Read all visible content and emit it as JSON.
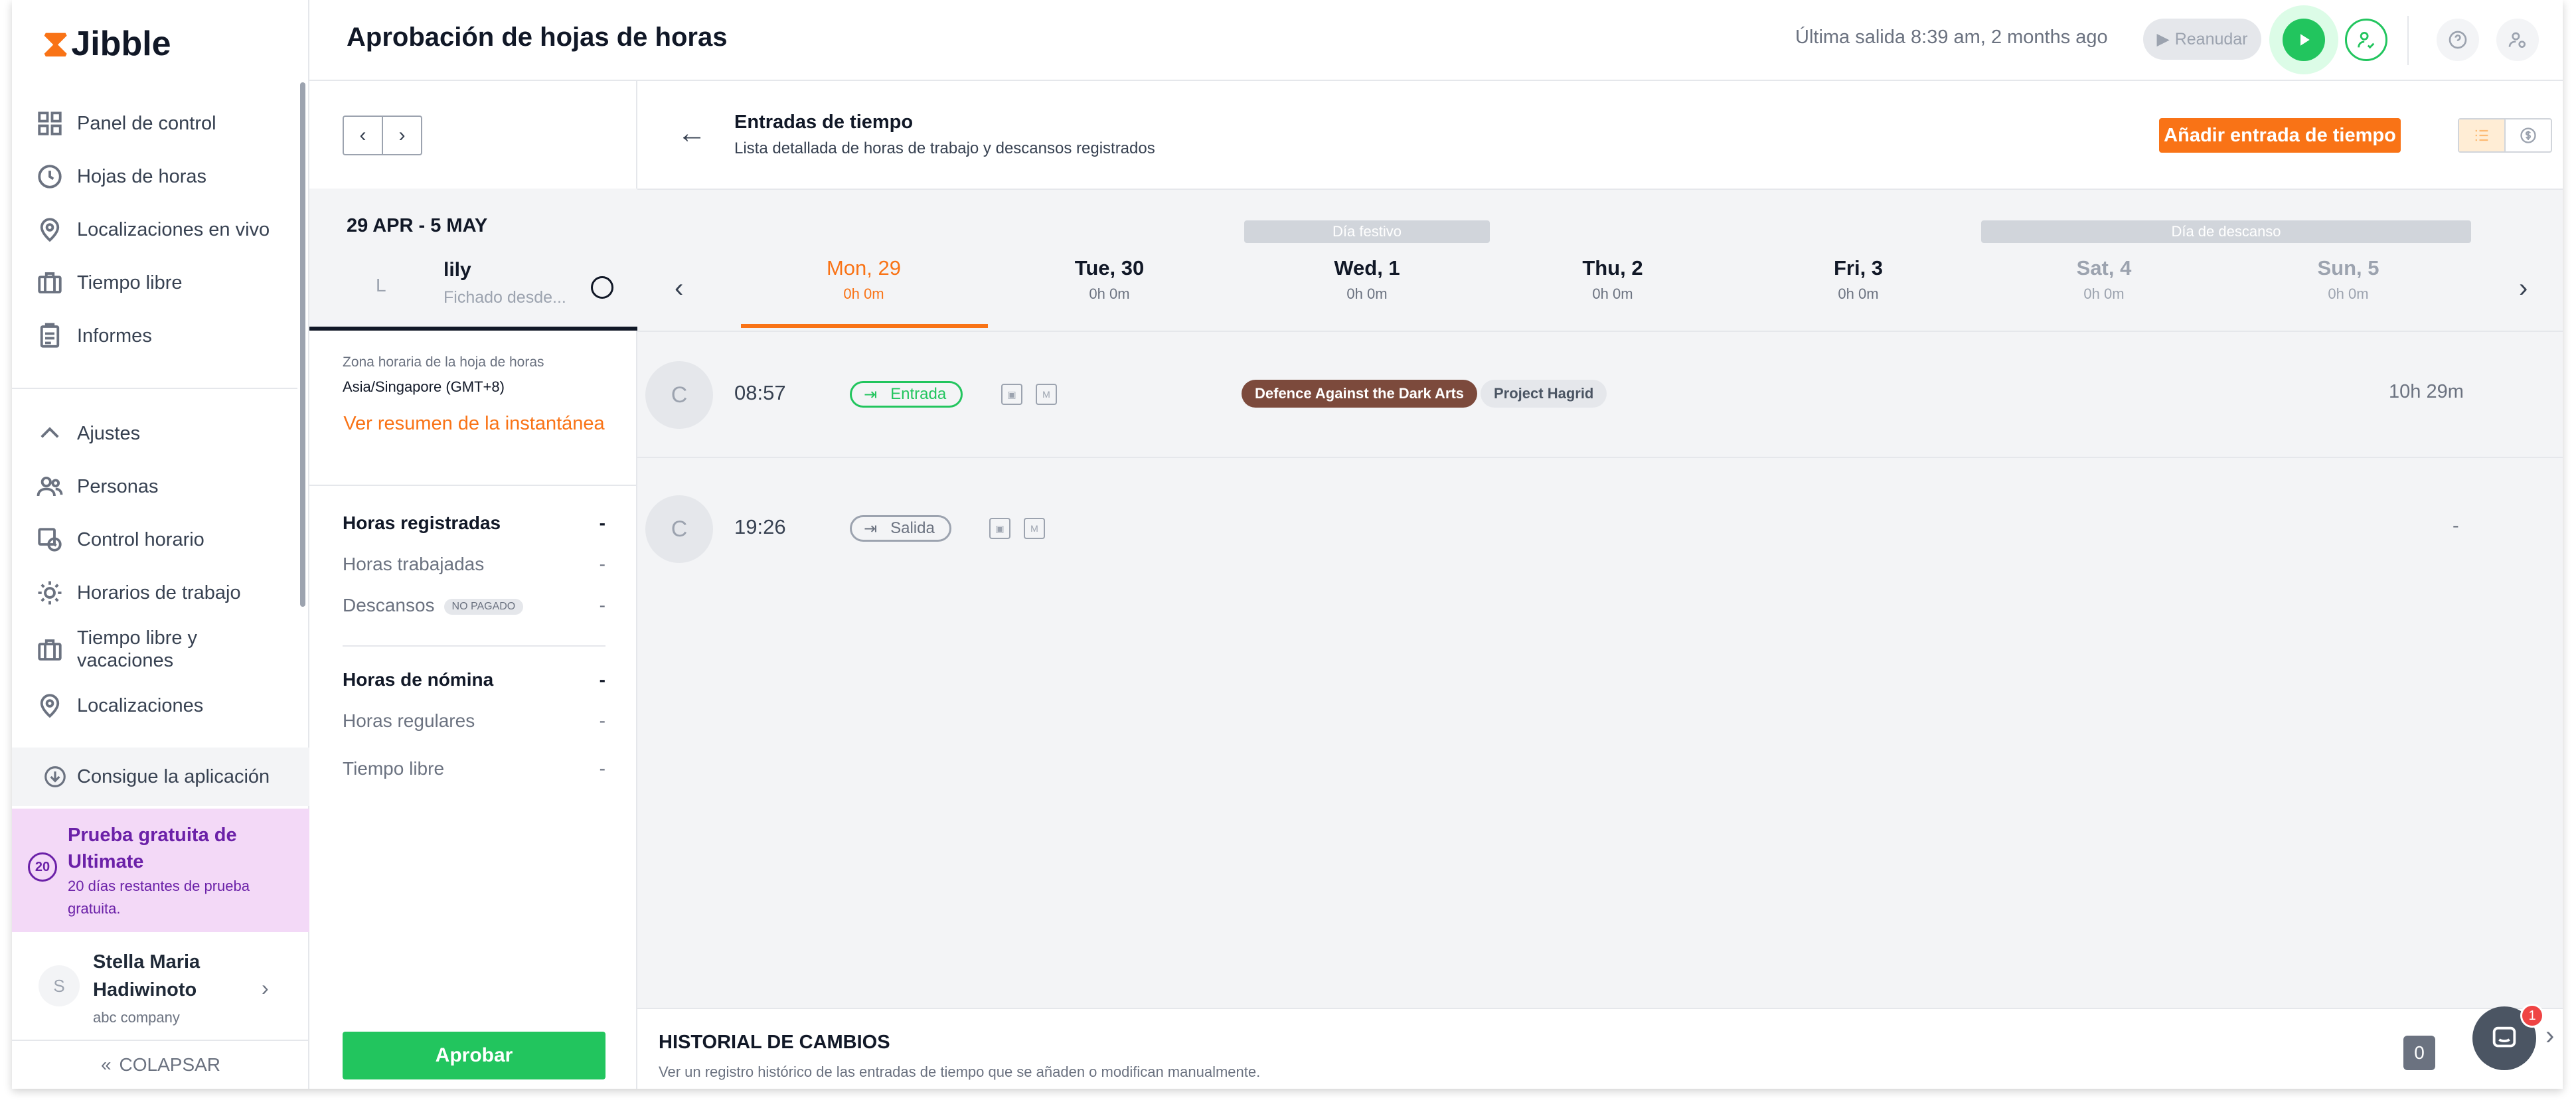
{
  "brand": {
    "name": "Jibble",
    "mark": "⧗"
  },
  "sidebar": {
    "items_top": [
      {
        "label": "Panel de control",
        "icon": "dashboard-icon"
      },
      {
        "label": "Hojas de horas",
        "icon": "clock-icon"
      },
      {
        "label": "Localizaciones en vivo",
        "icon": "location-pin-icon"
      },
      {
        "label": "Tiempo libre",
        "icon": "suitcase-icon"
      },
      {
        "label": "Informes",
        "icon": "clipboard-icon"
      }
    ],
    "settings_label": "Ajustes",
    "items_settings": [
      {
        "label": "Personas",
        "icon": "people-icon"
      },
      {
        "label": "Control horario",
        "icon": "time-tracking-icon"
      },
      {
        "label": "Horarios de trabajo",
        "icon": "schedule-icon"
      },
      {
        "label": "Tiempo libre y vacaciones",
        "icon": "suitcase-icon"
      },
      {
        "label": "Localizaciones",
        "icon": "location-pin-icon"
      }
    ],
    "get_app": "Consigue la aplicación",
    "trial": {
      "days": "20",
      "title": "Prueba gratuita de Ultimate",
      "subtitle": "20 días restantes de prueba gratuita."
    },
    "user": {
      "initial": "S",
      "name": "Stella Maria Hadiwinoto",
      "company": "abc company"
    },
    "collapse": "COLAPSAR"
  },
  "topbar": {
    "title": "Aprobación de hojas de horas",
    "last_exit": "Última salida 8:39 am, 2 months ago",
    "resume": "Reanudar"
  },
  "left_panel": {
    "week_range": "29 APR - 5 MAY",
    "member": {
      "initial": "L",
      "name": "lily",
      "sub": "Fichado desde..."
    },
    "tz_label": "Zona horaria de la hoja de horas",
    "tz_value": "Asia/Singapore (GMT+8)",
    "snapshot_link": "Ver resumen de la instantánea",
    "rows": [
      {
        "label": "Horas registradas",
        "value": "-",
        "bold": true
      },
      {
        "label": "Horas trabajadas",
        "value": "-"
      },
      {
        "label": "Descansos",
        "value": "-",
        "badge": "NO PAGADO"
      },
      {
        "label": "Horas de nómina",
        "value": "-",
        "bold": true
      },
      {
        "label": "Horas regulares",
        "value": "-"
      },
      {
        "label": "Tiempo libre",
        "value": "-"
      }
    ],
    "approve": "Aprobar"
  },
  "main": {
    "title": "Entradas de tiempo",
    "subtitle": "Lista detallada de horas de trabajo y descansos registrados",
    "add_button": "Añadir entrada de tiempo",
    "days": [
      {
        "name": "Mon, 29",
        "hours": "0h 0m",
        "state": "active"
      },
      {
        "name": "Tue, 30",
        "hours": "0h 0m",
        "state": ""
      },
      {
        "name": "Wed, 1",
        "hours": "0h 0m",
        "state": ""
      },
      {
        "name": "Thu, 2",
        "hours": "0h 0m",
        "state": ""
      },
      {
        "name": "Fri, 3",
        "hours": "0h 0m",
        "state": ""
      },
      {
        "name": "Sat, 4",
        "hours": "0h 0m",
        "state": "muted"
      },
      {
        "name": "Sun, 5",
        "hours": "0h 0m",
        "state": "muted"
      }
    ],
    "holiday_tag": "Día festivo",
    "rest_tag": "Día de descanso",
    "entries": [
      {
        "initial": "C",
        "time": "08:57",
        "type": "Entrada",
        "type_color": "#22c55e",
        "tags": [
          {
            "label": "Defence Against the Dark Arts",
            "bg": "#7c4a3c",
            "fg": "#ffffff"
          },
          {
            "label": "Project Hagrid",
            "bg": "#e5e7eb",
            "fg": "#4b5563"
          }
        ],
        "duration": "10h 29m"
      },
      {
        "initial": "C",
        "time": "19:26",
        "type": "Salida",
        "type_color": "#9ca3af",
        "tags": [],
        "duration": "-"
      }
    ],
    "history": {
      "title": "HISTORIAL DE CAMBIOS",
      "subtitle": "Ver un registro histórico de las entradas de tiempo que se añaden o modifican manualmente.",
      "count": "0"
    },
    "chat_badge": "1"
  },
  "colors": {
    "accent": "#f97316",
    "success": "#22c55e",
    "trial_bg": "#f3d9f7"
  }
}
